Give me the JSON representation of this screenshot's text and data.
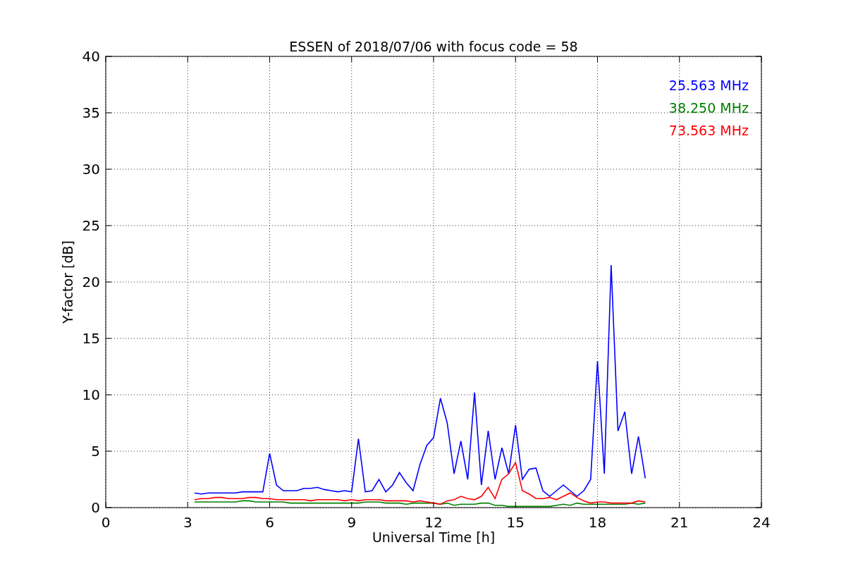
{
  "plot": {
    "chart_data": {
      "type": "line",
      "title": "ESSEN of 2018/07/06 with focus code = 58",
      "xlabel": "Universal Time [h]",
      "ylabel": "Y-factor [dB]",
      "x": [
        3.25,
        3.5,
        3.75,
        4,
        4.25,
        4.5,
        4.75,
        5,
        5.25,
        5.5,
        5.75,
        6,
        6.25,
        6.5,
        6.75,
        7,
        7.25,
        7.5,
        7.75,
        8,
        8.25,
        8.5,
        8.75,
        9,
        9.25,
        9.5,
        9.75,
        10,
        10.25,
        10.5,
        10.75,
        11,
        11.25,
        11.5,
        11.75,
        12,
        12.25,
        12.5,
        12.75,
        13,
        13.25,
        13.5,
        13.75,
        14,
        14.25,
        14.5,
        14.75,
        15,
        15.25,
        15.5,
        15.75,
        16,
        16.25,
        16.5,
        16.75,
        17,
        17.25,
        17.5,
        17.75,
        18,
        18.25,
        18.5,
        18.75,
        19,
        19.25,
        19.5,
        19.75
      ],
      "series": [
        {
          "name": "25.563 MHz",
          "color": "#0000ff",
          "values": [
            1.3,
            1.2,
            1.3,
            1.3,
            1.3,
            1.3,
            1.3,
            1.4,
            1.4,
            1.4,
            1.4,
            4.8,
            2.0,
            1.5,
            1.5,
            1.5,
            1.7,
            1.7,
            1.8,
            1.6,
            1.5,
            1.4,
            1.5,
            1.4,
            6.1,
            1.4,
            1.5,
            2.5,
            1.4,
            2.0,
            3.1,
            2.2,
            1.5,
            3.8,
            5.5,
            6.2,
            9.7,
            7.5,
            3.0,
            5.9,
            2.5,
            10.2,
            2.0,
            6.8,
            2.5,
            5.3,
            3.0,
            7.3,
            2.5,
            3.4,
            3.5,
            1.5,
            1.0,
            1.5,
            2.0,
            1.5,
            1.0,
            1.5,
            2.5,
            13.0,
            3.0,
            21.5,
            6.8,
            8.5,
            3.0,
            6.3,
            2.6
          ]
        },
        {
          "name": "38.250 MHz",
          "color": "#008000",
          "values": [
            0.5,
            0.5,
            0.5,
            0.5,
            0.5,
            0.5,
            0.5,
            0.6,
            0.6,
            0.5,
            0.5,
            0.5,
            0.5,
            0.5,
            0.4,
            0.4,
            0.4,
            0.4,
            0.4,
            0.4,
            0.4,
            0.4,
            0.4,
            0.4,
            0.4,
            0.5,
            0.5,
            0.5,
            0.4,
            0.4,
            0.4,
            0.3,
            0.4,
            0.4,
            0.4,
            0.4,
            0.3,
            0.4,
            0.2,
            0.3,
            0.3,
            0.3,
            0.4,
            0.4,
            0.2,
            0.2,
            0.1,
            0.1,
            0.1,
            0.1,
            0.1,
            0.1,
            0.1,
            0.2,
            0.3,
            0.2,
            0.4,
            0.3,
            0.3,
            0.3,
            0.3,
            0.3,
            0.3,
            0.3,
            0.4,
            0.3,
            0.4
          ]
        },
        {
          "name": "73.563 MHz",
          "color": "#ff0000",
          "values": [
            0.7,
            0.8,
            0.8,
            0.9,
            0.9,
            0.8,
            0.8,
            0.8,
            0.9,
            0.9,
            0.8,
            0.8,
            0.7,
            0.7,
            0.7,
            0.7,
            0.7,
            0.6,
            0.7,
            0.7,
            0.7,
            0.7,
            0.6,
            0.7,
            0.6,
            0.7,
            0.7,
            0.7,
            0.6,
            0.6,
            0.6,
            0.6,
            0.5,
            0.6,
            0.5,
            0.4,
            0.3,
            0.6,
            0.7,
            1.0,
            0.8,
            0.7,
            1.0,
            1.8,
            0.8,
            2.5,
            3.0,
            4.0,
            1.5,
            1.2,
            0.8,
            0.8,
            0.9,
            0.7,
            1.0,
            1.3,
            0.9,
            0.6,
            0.4,
            0.5,
            0.5,
            0.4,
            0.4,
            0.4,
            0.4,
            0.6,
            0.5
          ]
        }
      ],
      "xlim": [
        0,
        24
      ],
      "ylim": [
        0,
        40
      ],
      "xticks": [
        0,
        3,
        6,
        9,
        12,
        15,
        18,
        21,
        24
      ],
      "yticks": [
        0,
        5,
        10,
        15,
        20,
        25,
        30,
        35,
        40
      ],
      "grid": true
    }
  }
}
